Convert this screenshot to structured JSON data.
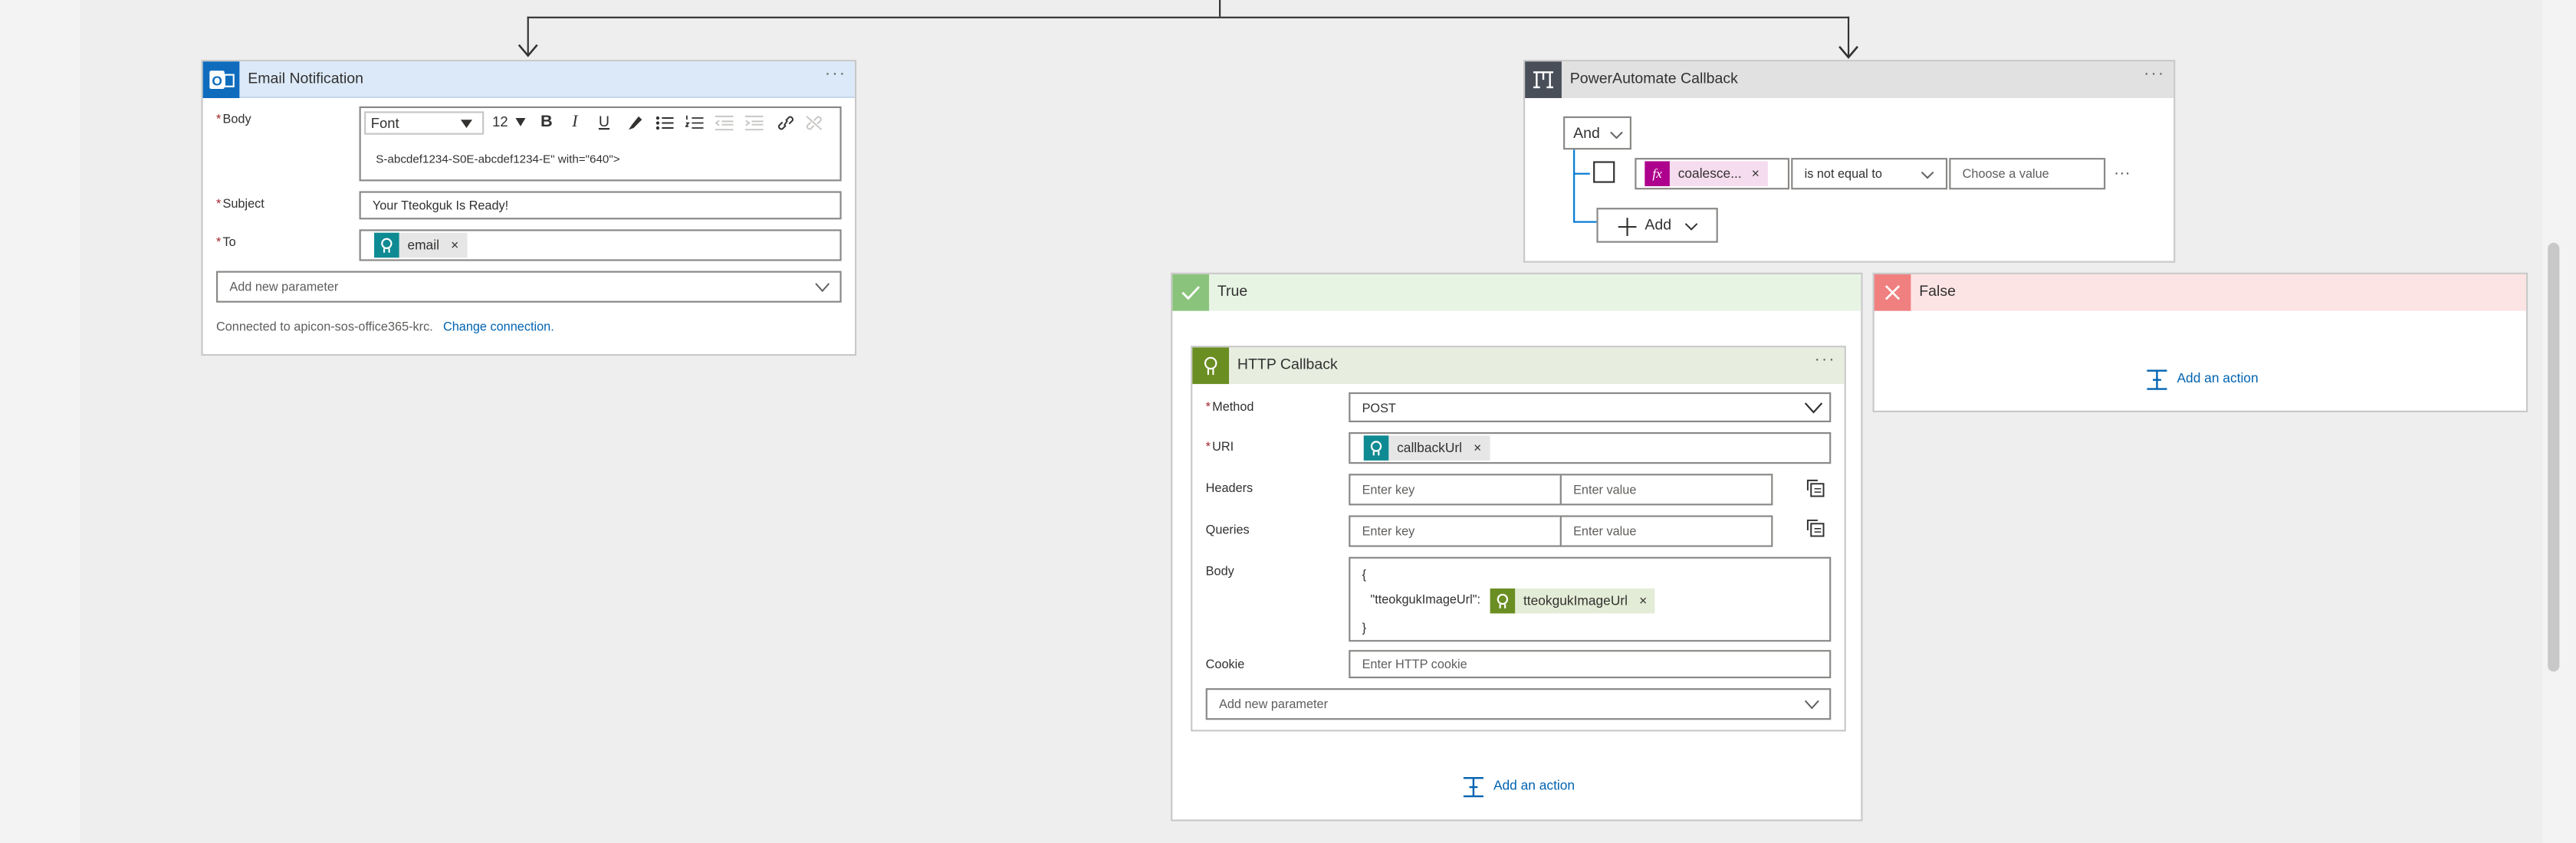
{
  "email": {
    "title": "Email Notification",
    "more": "···",
    "body_label": "Body",
    "toolbar": {
      "font": "Font",
      "size": "12",
      "bold": "B",
      "italic": "I",
      "underline": "U"
    },
    "body_text": "S-abcdef1234-S0E-abcdef1234-E\" with=\"640\">",
    "subject_label": "Subject",
    "subject_value": "Your Tteokguk Is Ready!",
    "to_label": "To",
    "to_token": "email",
    "add_param": "Add new parameter",
    "connection_text": "Connected to apicon-sos-office365-krc.",
    "change_connection": "Change connection."
  },
  "condition": {
    "title": "PowerAutomate Callback",
    "more": "···",
    "and_label": "And",
    "expr_token": "coalesce...",
    "operator": "is not equal to",
    "value_placeholder": "Choose a value",
    "row_more": "···",
    "add_label": "Add"
  },
  "true_branch": {
    "label": "True",
    "http": {
      "title": "HTTP Callback",
      "more": "···",
      "method_label": "Method",
      "method_value": "POST",
      "uri_label": "URI",
      "uri_token": "callbackUrl",
      "headers_label": "Headers",
      "queries_label": "Queries",
      "key_placeholder": "Enter key",
      "value_placeholder": "Enter value",
      "body_label": "Body",
      "body_open": "{",
      "body_key": "\"tteokgukImageUrl\":",
      "body_token": "tteokgukImageUrl",
      "body_close": "}",
      "cookie_label": "Cookie",
      "cookie_placeholder": "Enter HTTP cookie",
      "add_param": "Add new parameter"
    },
    "add_action": "Add an action"
  },
  "false_branch": {
    "label": "False",
    "add_action": "Add an action"
  },
  "colors": {
    "email_header": "#dce9f8",
    "condition_header": "#e1e1e1",
    "true_header": "#e7f4e4",
    "false_header": "#fce4e4",
    "http_header": "#e7eee0",
    "outlook_blue": "#0f6cbd",
    "token_teal": "#0e8a93",
    "token_green": "#6b8e23",
    "expr_magenta": "#ad008c",
    "link": "#0063b1"
  }
}
